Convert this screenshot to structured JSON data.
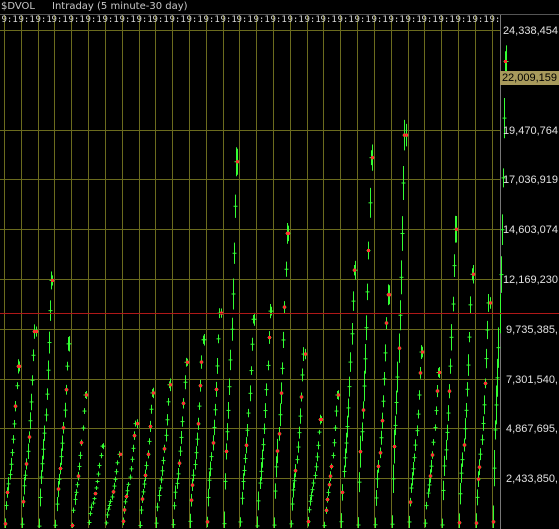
{
  "header": {
    "symbol": "$DVOL",
    "interval": "Intraday (5 minute-30 day)",
    "time_marker": "9:1"
  },
  "colors": {
    "background": "#000000",
    "grid": "#6b6b1e",
    "bars": "#33ff33",
    "markers": "#ff3030",
    "reference_line": "#b01818",
    "last_price_bg": "#a89a5c"
  },
  "chart_data": {
    "type": "line",
    "title": "$DVOL",
    "subtitle": "Intraday (5 minute-30 day)",
    "x_tick_label": "9:1",
    "x_tick_count": 30,
    "ylim": [
      0,
      24338454
    ],
    "y_ticks": [
      2433850,
      4867695,
      7301540,
      9735385,
      12169230,
      14603074,
      17036919,
      19470764,
      24338454
    ],
    "y_tick_labels": [
      "2,433,850,",
      "4,867,695,",
      "7,301,540,",
      "9,735,385,",
      "12,169,230",
      "14,603,074",
      "17,036,919",
      "19,470,764",
      "24,338,454"
    ],
    "last_value": 22009159,
    "last_value_label": "22,009,159",
    "reference_level": 10500000,
    "grid": true,
    "series": [
      {
        "type": "cumulative_intraday_volume",
        "peaks": [
          7900000,
          9600000,
          12100000,
          9000000,
          6500000,
          4000000,
          3600000,
          5100000,
          6600000,
          7000000,
          8100000,
          9200000,
          10500000,
          17900000,
          10200000,
          10600000,
          14400000,
          8500000,
          5300000,
          6500000,
          12600000,
          18100000,
          11400000,
          19200000,
          8600000,
          7600000,
          14600000,
          12400000,
          11000000,
          22800000
        ]
      }
    ]
  }
}
